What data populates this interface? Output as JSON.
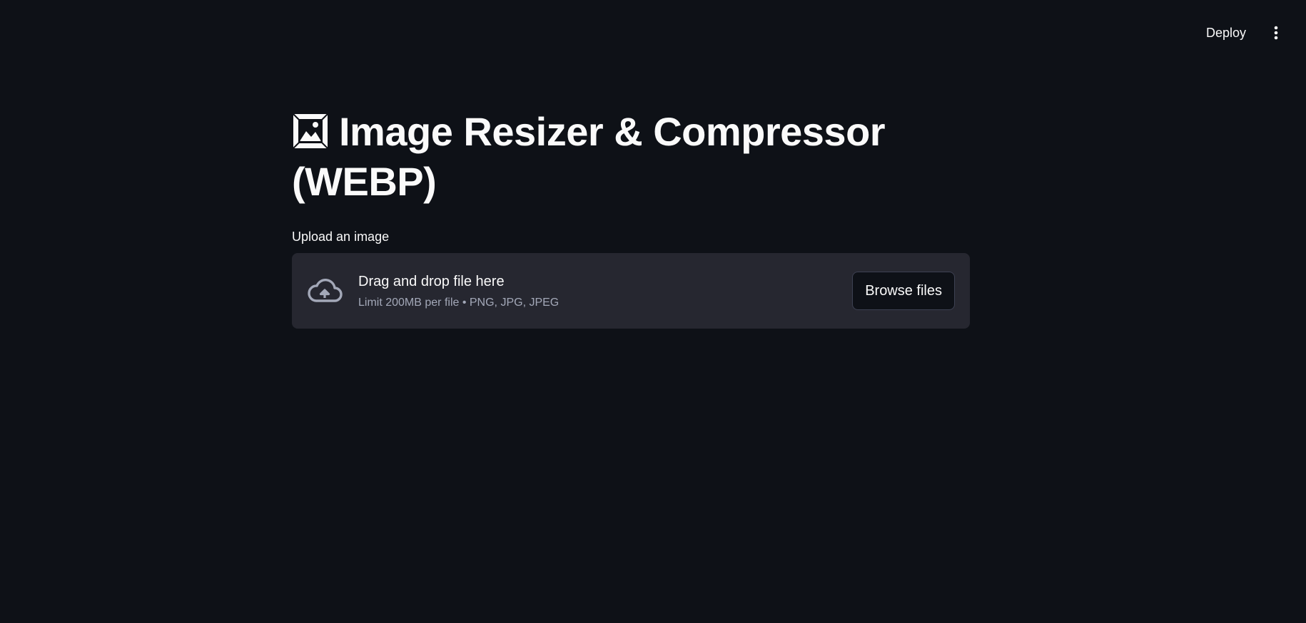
{
  "header": {
    "deploy_label": "Deploy",
    "menu_icon": "kebab-vertical-icon"
  },
  "main": {
    "title_icon": "framed-picture-icon",
    "title": "Image Resizer & Compressor (WEBP)"
  },
  "uploader": {
    "label": "Upload an image",
    "icon": "cloud-upload-icon",
    "drag_text": "Drag and drop file here",
    "limit_text": "Limit 200MB per file • PNG, JPG, JPEG",
    "browse_label": "Browse files"
  },
  "colors": {
    "background": "#0e1117",
    "dropzone": "#262730",
    "text": "#fafafa",
    "muted_text": "#a3a8b8"
  }
}
